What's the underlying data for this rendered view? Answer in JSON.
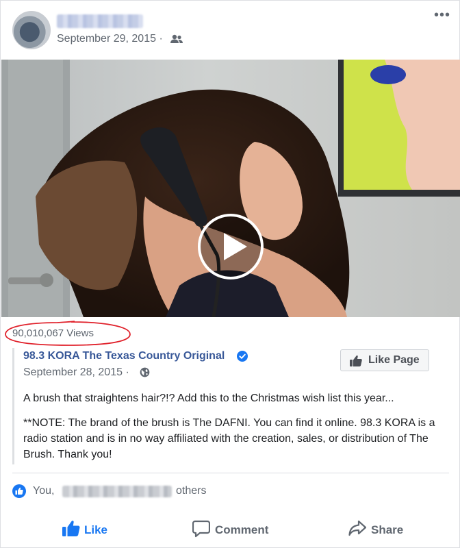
{
  "post": {
    "date": "September 29, 2015 ·",
    "more_label": "•••"
  },
  "video": {
    "views": "90,010,067 Views"
  },
  "shared": {
    "page_name": "98.3 KORA The Texas Country Original",
    "date": "September 28, 2015 ·",
    "like_page_label": "Like Page",
    "text_1": "A brush that straightens hair?!? Add this to the Christmas wish list this year...",
    "text_2": "**NOTE: The brand of the brush is The DAFNI. You can find it online. 98.3 KORA is a radio station and is in no way affiliated with the creation, sales, or distribution of The Brush. Thank you!"
  },
  "reactions": {
    "you": "You,",
    "others": "others"
  },
  "actions": {
    "like": "Like",
    "comment": "Comment",
    "share": "Share"
  },
  "colors": {
    "link": "#385898",
    "brand": "#1877f2",
    "secondary_text": "#606770",
    "annotation": "#e0202a"
  },
  "icons": [
    "friends-icon",
    "more-options-icon",
    "play-icon",
    "verified-icon",
    "globe-icon",
    "thumbs-up-icon",
    "comment-icon",
    "share-icon"
  ]
}
